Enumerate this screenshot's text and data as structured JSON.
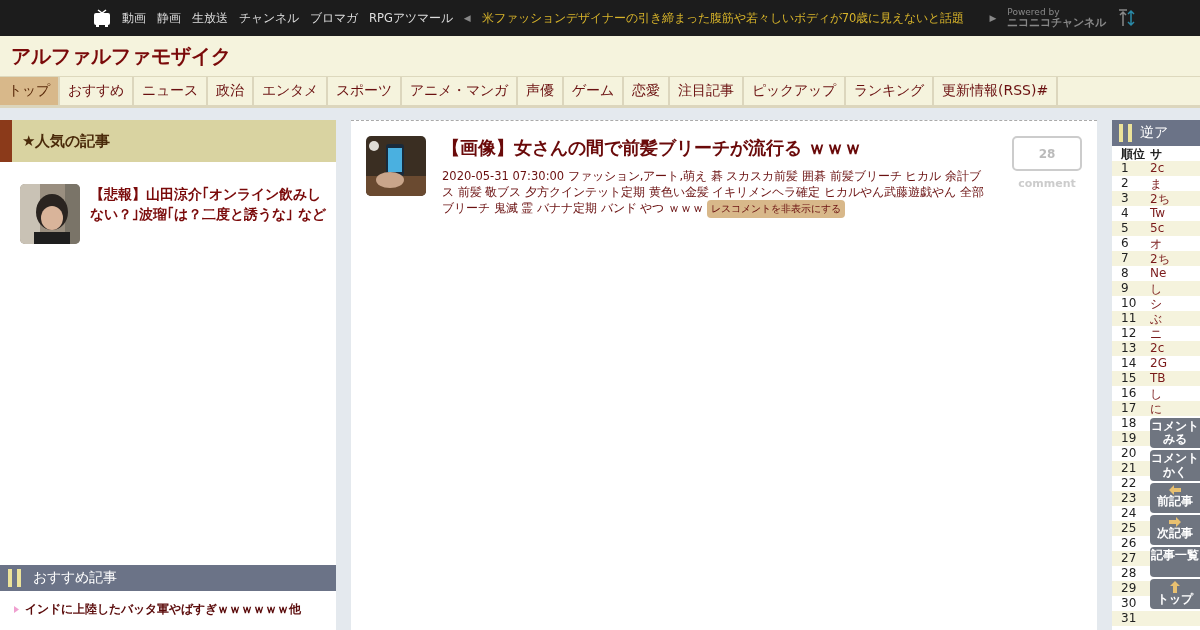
{
  "top_bar": {
    "links": [
      "動画",
      "静画",
      "生放送",
      "チャンネル",
      "ブロマガ",
      "RPGアツマール"
    ],
    "prev_arrow": "◀",
    "headline": "米ファッションデザイナーの引き締まった腹筋や若々しいボディが70歳に見えないと話題",
    "next_arrow": "▶",
    "powered_by": "Powered by",
    "channel_logo": "ニコニコチャンネル"
  },
  "site_title": "アルファルファモザイク",
  "nav": [
    {
      "label": "トップ",
      "selected": true
    },
    {
      "label": "おすすめ",
      "selected": false
    },
    {
      "label": "ニュース",
      "selected": false
    },
    {
      "label": "政治",
      "selected": false
    },
    {
      "label": "エンタメ",
      "selected": false
    },
    {
      "label": "スポーツ",
      "selected": false
    },
    {
      "label": "アニメ・マンガ",
      "selected": false
    },
    {
      "label": "声優",
      "selected": false
    },
    {
      "label": "ゲーム",
      "selected": false
    },
    {
      "label": "恋愛",
      "selected": false
    },
    {
      "label": "注目記事",
      "selected": false
    },
    {
      "label": "ピックアップ",
      "selected": false
    },
    {
      "label": "ランキング",
      "selected": false
    },
    {
      "label": "更新情報(RSS)#",
      "selected": false
    }
  ],
  "popular": {
    "title": "★人気の記事",
    "items": [
      {
        "title": "【悲報】山田涼介｢オンライン飲みしない？｣波瑠｢は？二度と誘うな｣ など"
      }
    ]
  },
  "recommended": {
    "title": "おすすめ記事",
    "items": [
      "インドに上陸したバッタ軍やばすぎｗｗｗｗｗｗ他"
    ]
  },
  "article": {
    "title": "【画像】女さんの間で前髪ブリーチが流行る ｗｗｗ",
    "meta": "2020-05-31 07:30:00 ファッション,アート,萌え 碁 スカスカ前髪 囲碁 前髪ブリーチ ヒカル 余計ブス 前髪 敬ブス 夕方クインテット定期 黄色い金髪 イキリメンヘラ確定 ヒカルやん武藤遊戯やん 全部ブリーチ 鬼滅 霊 バナナ定期 バンド やつ ｗｗｗ",
    "hide_button": "レスコメントを非表示にする",
    "comment_count": "28",
    "comment_label": "comment"
  },
  "ranking": {
    "title": "逆ア",
    "columns": [
      "順位",
      "サ"
    ],
    "rows": [
      {
        "rank": "1",
        "site": "2c"
      },
      {
        "rank": "2",
        "site": "ま"
      },
      {
        "rank": "3",
        "site": "2ち"
      },
      {
        "rank": "4",
        "site": "Tw"
      },
      {
        "rank": "5",
        "site": "5c"
      },
      {
        "rank": "6",
        "site": "オ"
      },
      {
        "rank": "7",
        "site": "2ち"
      },
      {
        "rank": "8",
        "site": "Ne"
      },
      {
        "rank": "9",
        "site": "し"
      },
      {
        "rank": "10",
        "site": "シ"
      },
      {
        "rank": "11",
        "site": "ぶ"
      },
      {
        "rank": "12",
        "site": "ニ"
      },
      {
        "rank": "13",
        "site": "2c"
      },
      {
        "rank": "14",
        "site": "2G"
      },
      {
        "rank": "15",
        "site": "TB"
      },
      {
        "rank": "16",
        "site": "し"
      },
      {
        "rank": "17",
        "site": "に"
      },
      {
        "rank": "18"
      },
      {
        "rank": "19"
      },
      {
        "rank": "20"
      },
      {
        "rank": "21"
      },
      {
        "rank": "22"
      },
      {
        "rank": "23"
      },
      {
        "rank": "24"
      },
      {
        "rank": "25"
      },
      {
        "rank": "26"
      },
      {
        "rank": "27"
      },
      {
        "rank": "28"
      },
      {
        "rank": "29"
      },
      {
        "rank": "30"
      },
      {
        "rank": "31"
      }
    ]
  },
  "float_buttons": [
    {
      "label": "コメントみる",
      "kind": "text"
    },
    {
      "label": "コメントかく",
      "kind": "text"
    },
    {
      "label": "前記事",
      "kind": "left"
    },
    {
      "label": "次記事",
      "kind": "right"
    },
    {
      "label": "記事一覧",
      "kind": "text"
    },
    {
      "label": "トップ",
      "kind": "up"
    }
  ]
}
